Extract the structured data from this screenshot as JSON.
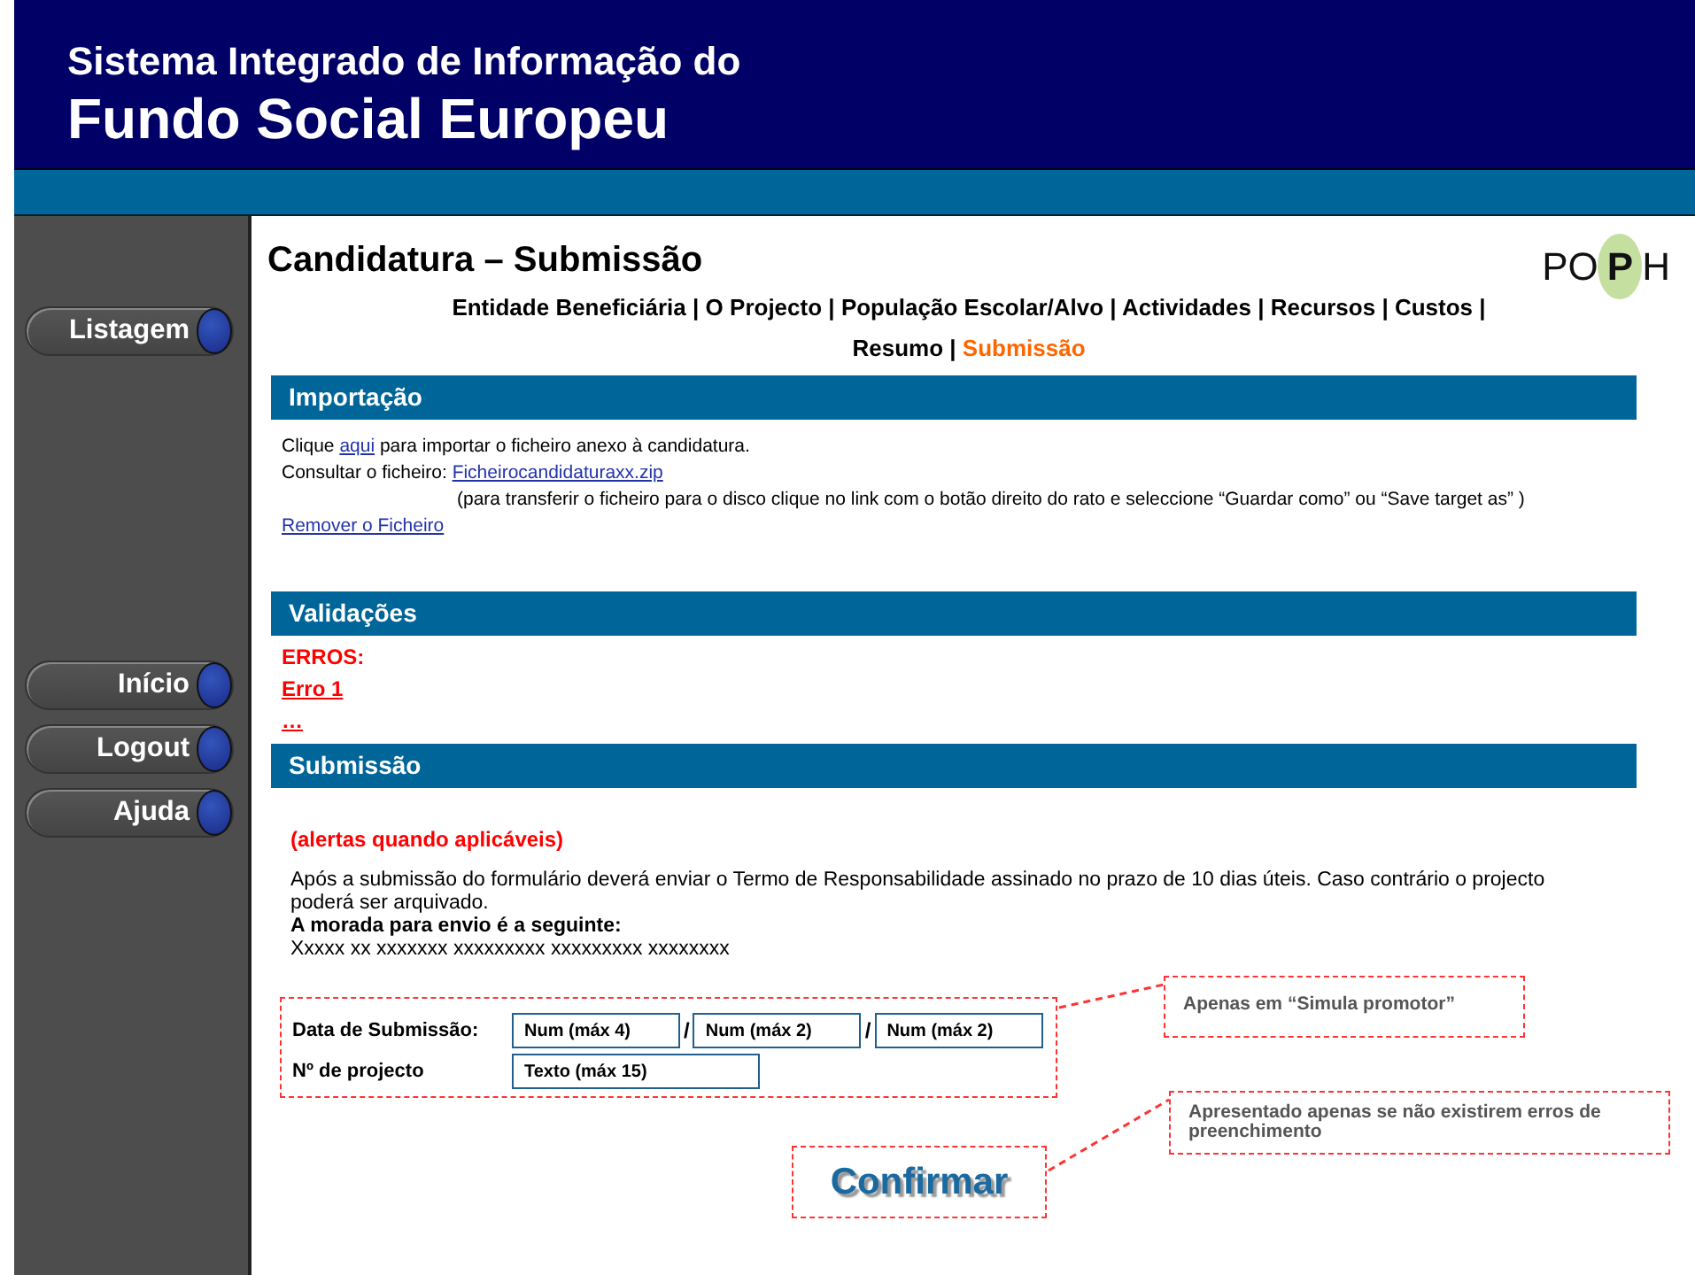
{
  "header": {
    "line1": "Sistema Integrado de Informação do",
    "line2": "Fundo Social Europeu"
  },
  "sidebar": {
    "primary": [
      {
        "label": "Listagem"
      }
    ],
    "secondary": [
      {
        "label": "Início"
      },
      {
        "label": "Logout"
      },
      {
        "label": "Ajuda"
      }
    ]
  },
  "page_title": "Candidatura – Submissão",
  "logo": {
    "parts": [
      "PO",
      "P",
      "H"
    ]
  },
  "nav": {
    "separator": "|",
    "items": [
      {
        "label": "Entidade Beneficiária",
        "selected": false
      },
      {
        "label": "O Projecto",
        "selected": false
      },
      {
        "label": "População Escolar/Alvo",
        "selected": false
      },
      {
        "label": "Actividades",
        "selected": false
      },
      {
        "label": "Recursos",
        "selected": false
      },
      {
        "label": "Custos",
        "selected": false
      },
      {
        "label": "Resumo",
        "selected": false
      },
      {
        "label": "Submissão",
        "selected": true
      }
    ]
  },
  "importacao": {
    "title": "Importação",
    "import_line": {
      "before": "Clique ",
      "link": "aqui",
      "after": " para importar o ficheiro anexo à candidatura."
    },
    "file_label": "Consultar o ficheiro:",
    "file_link": "Ficheirocandidaturaxx.zip",
    "note": "(para transferir o ficheiro para o disco clique no link com o botão direito do rato e seleccione “Guardar como” ou “Save target as” )",
    "remove_link": "Remover o Ficheiro"
  },
  "validacoes": {
    "title": "Validações",
    "errors_label": "ERROS:",
    "errors": [
      "Erro 1",
      "…"
    ]
  },
  "submissao": {
    "title": "Submissão",
    "alert": "(alertas quando aplicáveis)",
    "paragraph": "Após a submissão do formulário deverá enviar o Termo de Responsabilidade assinado no prazo de 10 dias úteis. Caso contrário o projecto poderá ser arquivado.",
    "address_label": "A morada para envio é a seguinte:",
    "address": "Xxxxx xx xxxxxxx xxxxxxxxx xxxxxxxxx xxxxxxxx",
    "date_label": "Data de Submissão:",
    "date_separator": "/",
    "date_fields": [
      {
        "placeholder": "Num (máx 4)"
      },
      {
        "placeholder": "Num (máx 2)"
      },
      {
        "placeholder": "Num (máx 2)"
      }
    ],
    "project_label": "Nº de projecto",
    "project_field": {
      "placeholder": "Texto (máx 15)"
    },
    "confirm": "Confirmar",
    "annotations": [
      "Apenas em “Simula promotor”",
      "Apresentado apenas se não existirem erros de preenchimento"
    ]
  }
}
